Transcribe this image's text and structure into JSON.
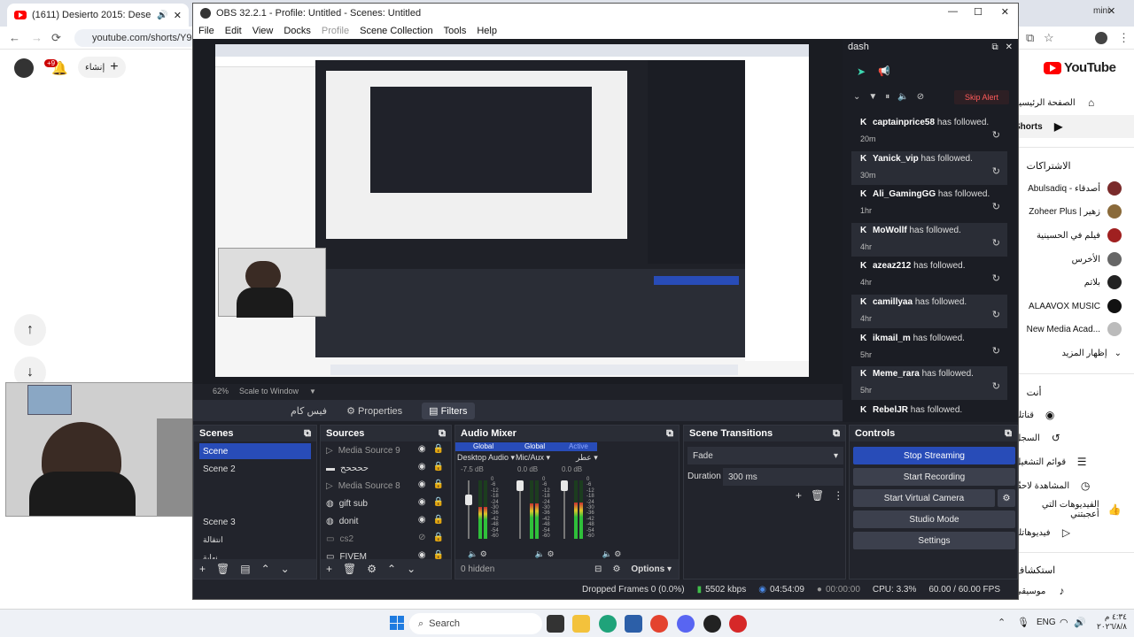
{
  "browser": {
    "tab_title": "(1611) Desierto 2015: Dese",
    "url": "youtube.com/shorts/Y9zicz",
    "right_tab_fragment": "mini"
  },
  "youtube": {
    "logo_text": "YouTube",
    "nav": [
      {
        "label": "الصفحة الرئيسية",
        "icon": "home-icon"
      },
      {
        "label": "Shorts",
        "icon": "shorts-icon"
      }
    ],
    "subs_header": "الاشتراكات",
    "channels": [
      "Abulsadiq - أصدقاء",
      "Zoheer Plus | زهير",
      "فيلم في الحسينية",
      "الأخرس",
      "بلاتم",
      "ALAAVOX MUSIC",
      "New Media Acad...",
      "إظهار المزيد"
    ],
    "you_header": "أنت",
    "you_items": [
      "قناتك",
      "السجلّ",
      "قوائم التشغيل",
      "المشاهدة لاحقًا",
      "الفيديوهات التي أعجبتني",
      "فيديوهاتك"
    ],
    "explore_header": "استكشاف",
    "explore_items": [
      "موسيقى"
    ],
    "create_label": "إنشاء",
    "notif_count": "+9"
  },
  "obs": {
    "title": "OBS 32.2.1 - Profile: Untitled - Scenes: Untitled",
    "menu": [
      "File",
      "Edit",
      "View",
      "Docks",
      "Profile",
      "Scene Collection",
      "Tools",
      "Help"
    ],
    "preview_zoom": "62%",
    "scale_mode": "Scale to Window",
    "selected_source": "فيس كام",
    "properties_label": "Properties",
    "filters_label": "Filters",
    "scenes": {
      "title": "Scenes",
      "items": [
        "Scene",
        "Scene 2",
        "Scene 3",
        "انتقالة",
        "نهاية"
      ]
    },
    "sources": {
      "title": "Sources",
      "items": [
        "Media Source 9",
        "ححححح",
        "Media Source 8",
        "gift sub",
        "donit",
        "cs2",
        "FIVEM"
      ]
    },
    "audio_mixer": {
      "title": "Audio Mixer",
      "channels": [
        {
          "name": "Desktop Audio",
          "db": "-7.5 dB",
          "tag": "Global",
          "level": 0.55
        },
        {
          "name": "Mic/Aux",
          "db": "0.0 dB",
          "tag": "Global",
          "level": 0.6
        },
        {
          "name": "عطر",
          "db": "0.0 dB",
          "tag": "Active",
          "level": 0.62
        }
      ],
      "scale": [
        "0",
        "-6",
        "-12",
        "-18",
        "-24",
        "-30",
        "-36",
        "-42",
        "-48",
        "-54",
        "-60"
      ],
      "hidden_label": "0 hidden",
      "options_label": "Options"
    },
    "transitions": {
      "title": "Scene Transitions",
      "selected": "Fade",
      "duration_label": "Duration",
      "duration_value": "300 ms"
    },
    "controls": {
      "title": "Controls",
      "stop_streaming": "Stop Streaming",
      "start_recording": "Start Recording",
      "start_virtual_camera": "Start Virtual Camera",
      "studio_mode": "Studio Mode",
      "settings": "Settings"
    },
    "dash": {
      "title": "dash",
      "skip_alert": "Skip Alert",
      "alerts": [
        {
          "name": "captainprice58",
          "action": "has followed.",
          "ago": "20m"
        },
        {
          "name": "Yanick_vip",
          "action": "has followed.",
          "ago": "30m"
        },
        {
          "name": "Ali_GamingGG",
          "action": "has followed.",
          "ago": "1hr"
        },
        {
          "name": "MoWollf",
          "action": "has followed.",
          "ago": "4hr"
        },
        {
          "name": "azeaz212",
          "action": "has followed.",
          "ago": "4hr"
        },
        {
          "name": "camillyaa",
          "action": "has followed.",
          "ago": "4hr"
        },
        {
          "name": "ikmail_m",
          "action": "has followed.",
          "ago": "5hr"
        },
        {
          "name": "Meme_rara",
          "action": "has followed.",
          "ago": "5hr"
        },
        {
          "name": "RebelJR",
          "action": "has followed.",
          "ago": ""
        }
      ]
    },
    "status": {
      "dropped": "Dropped Frames 0 (0.0%)",
      "kbps": "5502 kbps",
      "live_time": "04:54:09",
      "rec_time": "00:00:00",
      "cpu": "CPU: 3.3%",
      "fps": "60.00 / 60.00 FPS"
    }
  },
  "taskbar": {
    "search_label": "Search",
    "lang": "ENG",
    "time": "٤:٣٤ م",
    "date": "٢٠٢٦/٨/٨"
  }
}
